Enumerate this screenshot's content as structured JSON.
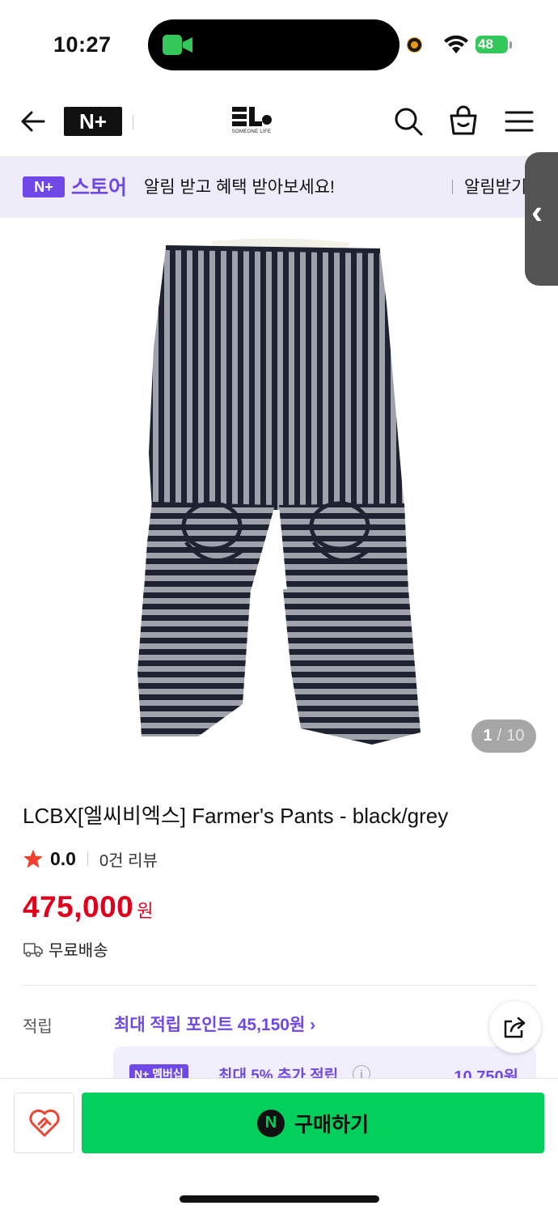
{
  "status_bar": {
    "time": "10:27",
    "battery": "48"
  },
  "header": {
    "left_logo": "N+",
    "brand_name": "SOMEONE LIFE"
  },
  "banner": {
    "badge": "N+",
    "brand": "스토어",
    "message": "알림 받고 혜택 받아보세요!",
    "action": "알림받기"
  },
  "gallery": {
    "current": "1",
    "total": "10"
  },
  "product": {
    "title": "LCBX[엘씨비엑스] Farmer's Pants - black/grey",
    "rating": "0.0",
    "review_count": "0건 리뷰",
    "price": "475,000",
    "price_unit": "원",
    "shipping": "무료배송"
  },
  "points": {
    "label": "적립",
    "value": "최대 적립 포인트 45,150원",
    "membership_badge": "N+ 멤버십",
    "membership_text": "최대 5% 추가 적립",
    "membership_amount": "10,750원"
  },
  "bottom": {
    "buy_label": "구매하기",
    "buy_logo": "N"
  },
  "colors": {
    "naver_green": "#03cf5d",
    "price_red": "#e0001b",
    "accent_purple": "#7048e8"
  }
}
